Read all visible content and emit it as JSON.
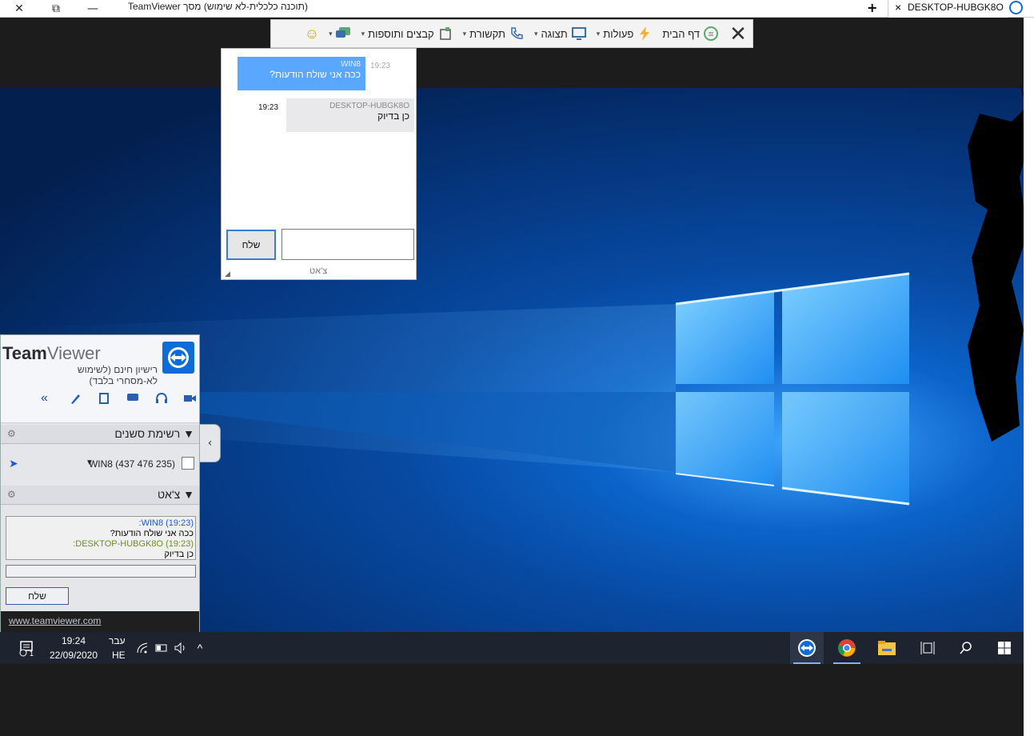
{
  "titlebar": {
    "window_title": "(תוכנה כלכלית-לא שימוש) מסך TeamViewer",
    "tab_label": "DESKTOP-HUBGK8O",
    "tab_close": "×",
    "add_tab": "+",
    "close_glyph": "✕",
    "restore_glyph": "⧉",
    "minimize_glyph": "—"
  },
  "toolbar": {
    "close": "✕",
    "home": "דף הבית",
    "actions": "פעולות",
    "view": "תצוגה",
    "communicate": "תקשורת",
    "files": "קבצים ותוספות",
    "caret": "▾",
    "smiley": "☺"
  },
  "chat_popup": {
    "messages": [
      {
        "sender": "WIN8",
        "time": "19:23",
        "text": "ככה אני שולח הודעות?"
      },
      {
        "sender": "DESKTOP-HUBGK8O",
        "time": "19:23",
        "text": "כן בדיוק"
      }
    ],
    "send_label": "שלח",
    "panel_label": "צ'אט"
  },
  "teamviewer_panel": {
    "logo_team": "Team",
    "logo_viewer": "Viewer",
    "subtitle": "רישיון חינם (לשימוש לא-מסחרי בלבד)",
    "sessions_title": "רשימת סשנים",
    "session_entry": "WIN8 (437 476 235)",
    "chat_title": "צ'אט",
    "chat_log": [
      {
        "who": "WIN8 (19:23):",
        "text": "ככה אני שולח הודעות?"
      },
      {
        "who": "DESKTOP-HUBGK8O (19:23):",
        "text": "כן בדיוק"
      }
    ],
    "send_label": "שלח",
    "website": "www.teamviewer.com",
    "collapse": "«",
    "tab_arrow": "‹"
  },
  "taskbar": {
    "time": "19:24",
    "date": "22/09/2020",
    "lang_top": "עבר",
    "lang_code": "HE",
    "notifications": "1",
    "tray_chevron": "^"
  },
  "colors": {
    "accent": "#0e6cd6",
    "bubble_me": "#5aa7ff",
    "bubble_them": "#e9e9ec",
    "taskbar": "#1d2430"
  }
}
